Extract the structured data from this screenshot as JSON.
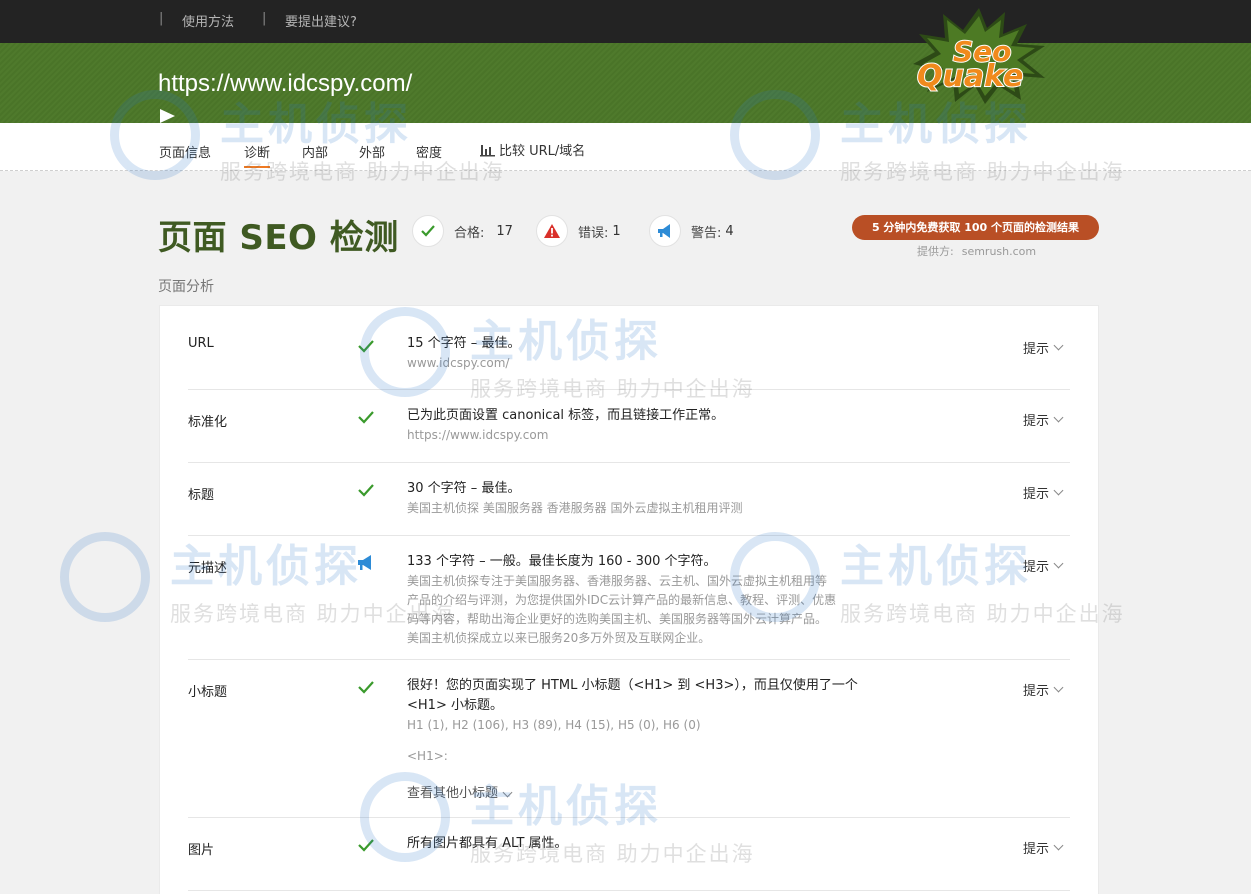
{
  "topbar": {
    "sep": "|",
    "links": [
      "使用方法",
      "要提出建议?"
    ]
  },
  "header": {
    "url": "https://www.idcspy.com/",
    "logo_top": "Seo",
    "logo_bottom": "Quake"
  },
  "nav": {
    "tabs": [
      "页面信息",
      "诊断",
      "内部",
      "外部",
      "密度"
    ],
    "active_tab": "诊断",
    "compare_label": "比较 URL/域名"
  },
  "summary": {
    "title": "页面 SEO 检测",
    "pass_label": "合格:",
    "pass_count": "17",
    "error_label": "错误:",
    "error_count": "1",
    "warn_label": "警告:",
    "warn_count": "4",
    "semrush_button": "5 分钟内免费获取 100 个页面的检测结果",
    "provider_label": "提供方:",
    "provider_name": "semrush.com"
  },
  "section_label": "页面分析",
  "tip_label": "提示",
  "rows": [
    {
      "label": "URL",
      "status": "pass",
      "main": "15 个字符 – 最佳。",
      "sub": "www.idcspy.com/"
    },
    {
      "label": "标准化",
      "status": "pass",
      "main": "已为此页面设置 canonical 标签，而且链接工作正常。",
      "sub": "https://www.idcspy.com"
    },
    {
      "label": "标题",
      "status": "pass",
      "main": "30 个字符 – 最佳。",
      "sub": "美国主机侦探 美国服务器 香港服务器 国外云虚拟主机租用评测"
    },
    {
      "label": "元描述",
      "status": "warning",
      "main": "133 个字符 – 一般。最佳长度为 160 - 300 个字符。",
      "sub_lines": [
        "美国主机侦探专注于美国服务器、香港服务器、云主机、国外云虚拟主机租用等",
        "产品的介绍与评测，为您提供国外IDC云计算产品的最新信息、教程、评测、优惠",
        "码等内容，帮助出海企业更好的选购美国主机、美国服务器等国外云计算产品。",
        "美国主机侦探成立以来已服务20多万外贸及互联网企业。"
      ]
    },
    {
      "label": "小标题",
      "status": "pass",
      "main_lines": [
        "很好！您的页面实现了 HTML 小标题（<H1> 到 <H3>），而且仅使用了一个",
        "<H1> 小标题。"
      ],
      "sub": "H1 (1), H2 (106), H3 (89), H4 (15), H5 (0), H6 (0)",
      "h1_label": "<H1>:",
      "more_label": "查看其他小标题"
    },
    {
      "label": "图片",
      "status": "pass",
      "main": "所有图片都具有 ALT 属性。"
    }
  ],
  "watermark": {
    "title": "主机侦探",
    "subtitle": "服务跨境电商 助力中企出海"
  },
  "colors": {
    "brand_green": "#4a7428",
    "title_green": "#3f5a22",
    "pass": "#3a9a2c",
    "error": "#d9302a",
    "warning": "#2d8bd6",
    "semrush": "#b94f25",
    "active_tab": "#f07a22"
  }
}
